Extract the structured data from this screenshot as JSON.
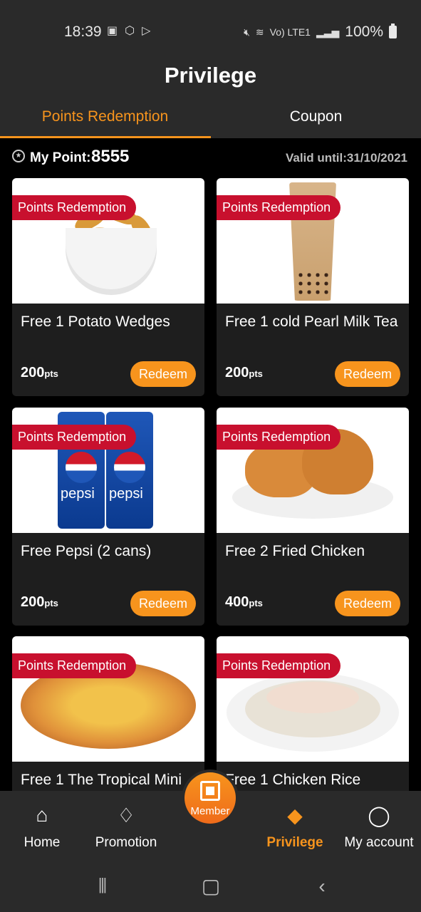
{
  "status_bar": {
    "time": "18:39",
    "network": "Vo) LTE1",
    "battery": "100%"
  },
  "header": {
    "title": "Privilege",
    "tabs": [
      {
        "label": "Points Redemption",
        "active": true
      },
      {
        "label": "Coupon",
        "active": false
      }
    ]
  },
  "points": {
    "label": "My Point:",
    "value": "8555",
    "valid_until": "Valid until:31/10/2021"
  },
  "cards": [
    {
      "badge": "Points Redemption",
      "title": "Free 1 Potato Wedges",
      "pts": "200",
      "pts_unit": "pts",
      "button": "Redeem",
      "image": "potato-wedges"
    },
    {
      "badge": "Points Redemption",
      "title": "Free 1 cold Pearl Milk Tea",
      "pts": "200",
      "pts_unit": "pts",
      "button": "Redeem",
      "image": "pearl-milk-tea"
    },
    {
      "badge": "Points Redemption",
      "title": "Free Pepsi (2 cans)",
      "pts": "200",
      "pts_unit": "pts",
      "button": "Redeem",
      "image": "pepsi-cans"
    },
    {
      "badge": "Points Redemption",
      "title": "Free 2 Fried Chicken",
      "pts": "400",
      "pts_unit": "pts",
      "button": "Redeem",
      "image": "fried-chicken"
    },
    {
      "badge": "Points Redemption",
      "title": "Free 1 The Tropical Mini",
      "pts": "",
      "pts_unit": "",
      "button": "",
      "image": "pizza"
    },
    {
      "badge": "Points Redemption",
      "title": "Free 1 Chicken Rice",
      "pts": "",
      "pts_unit": "",
      "button": "",
      "image": "chicken-rice"
    }
  ],
  "bottom_nav": {
    "items": [
      {
        "label": "Home",
        "icon": "home-icon"
      },
      {
        "label": "Promotion",
        "icon": "diamond-icon"
      },
      {
        "label": "Privilege",
        "icon": "tag-icon",
        "active": true
      },
      {
        "label": "My account",
        "icon": "user-icon"
      }
    ],
    "member_label": "Member"
  },
  "colors": {
    "accent": "#f7941d",
    "badge": "#c8102e",
    "background": "#000000",
    "surface": "#2a2a2a",
    "card": "#1e1e1e"
  }
}
